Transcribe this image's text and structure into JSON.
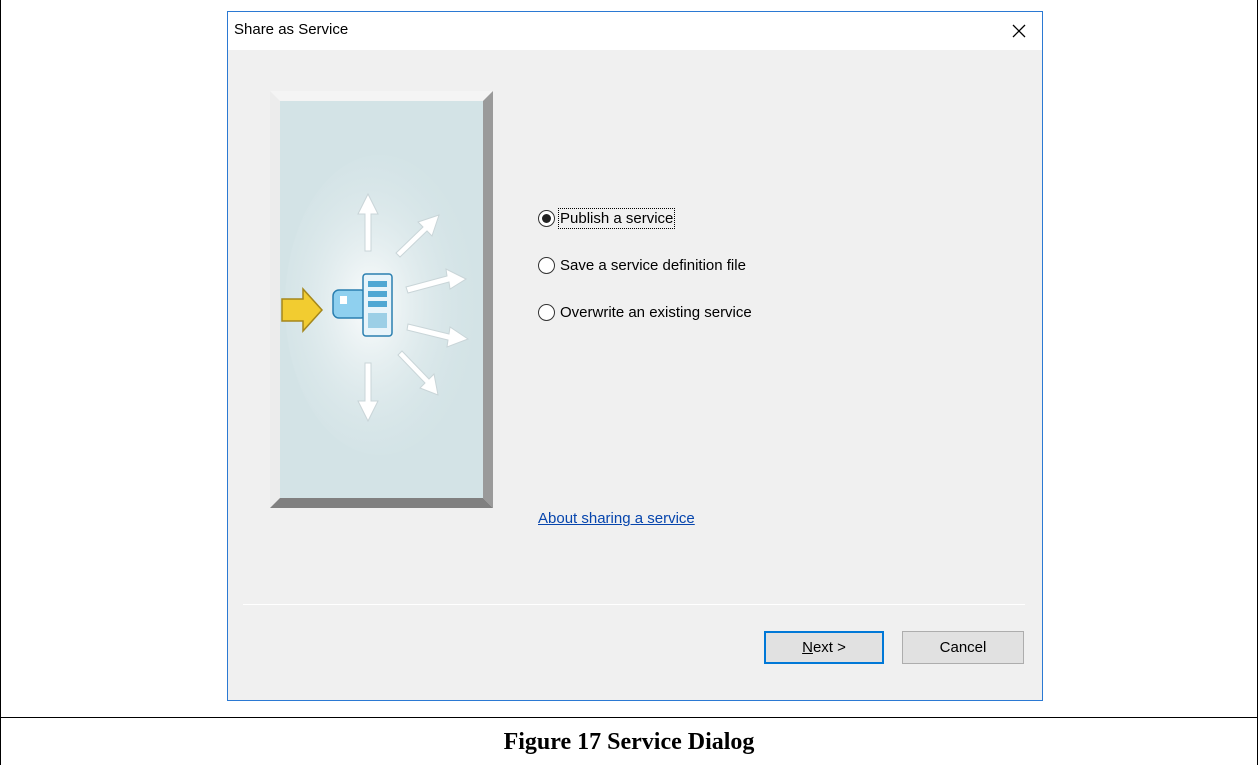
{
  "dialog": {
    "title": "Share as Service",
    "close_icon": "close-icon",
    "illustration_icon": "service-publish-illustration",
    "options": [
      {
        "label": "Publish a service",
        "checked": true
      },
      {
        "label": "Save a service definition file",
        "checked": false
      },
      {
        "label": "Overwrite an existing service",
        "checked": false
      }
    ],
    "help_link": "About sharing a service",
    "buttons": {
      "next": "Next >",
      "cancel": "Cancel"
    }
  },
  "caption": "Figure 17 Service Dialog",
  "colors": {
    "dialog_border": "#2b79d3",
    "dialog_bg": "#f0f0f0",
    "link": "#0645ad",
    "default_button_border": "#0078d7",
    "illustration_panel": "#d3e3e6",
    "arrow_accent": "#f0c020"
  }
}
